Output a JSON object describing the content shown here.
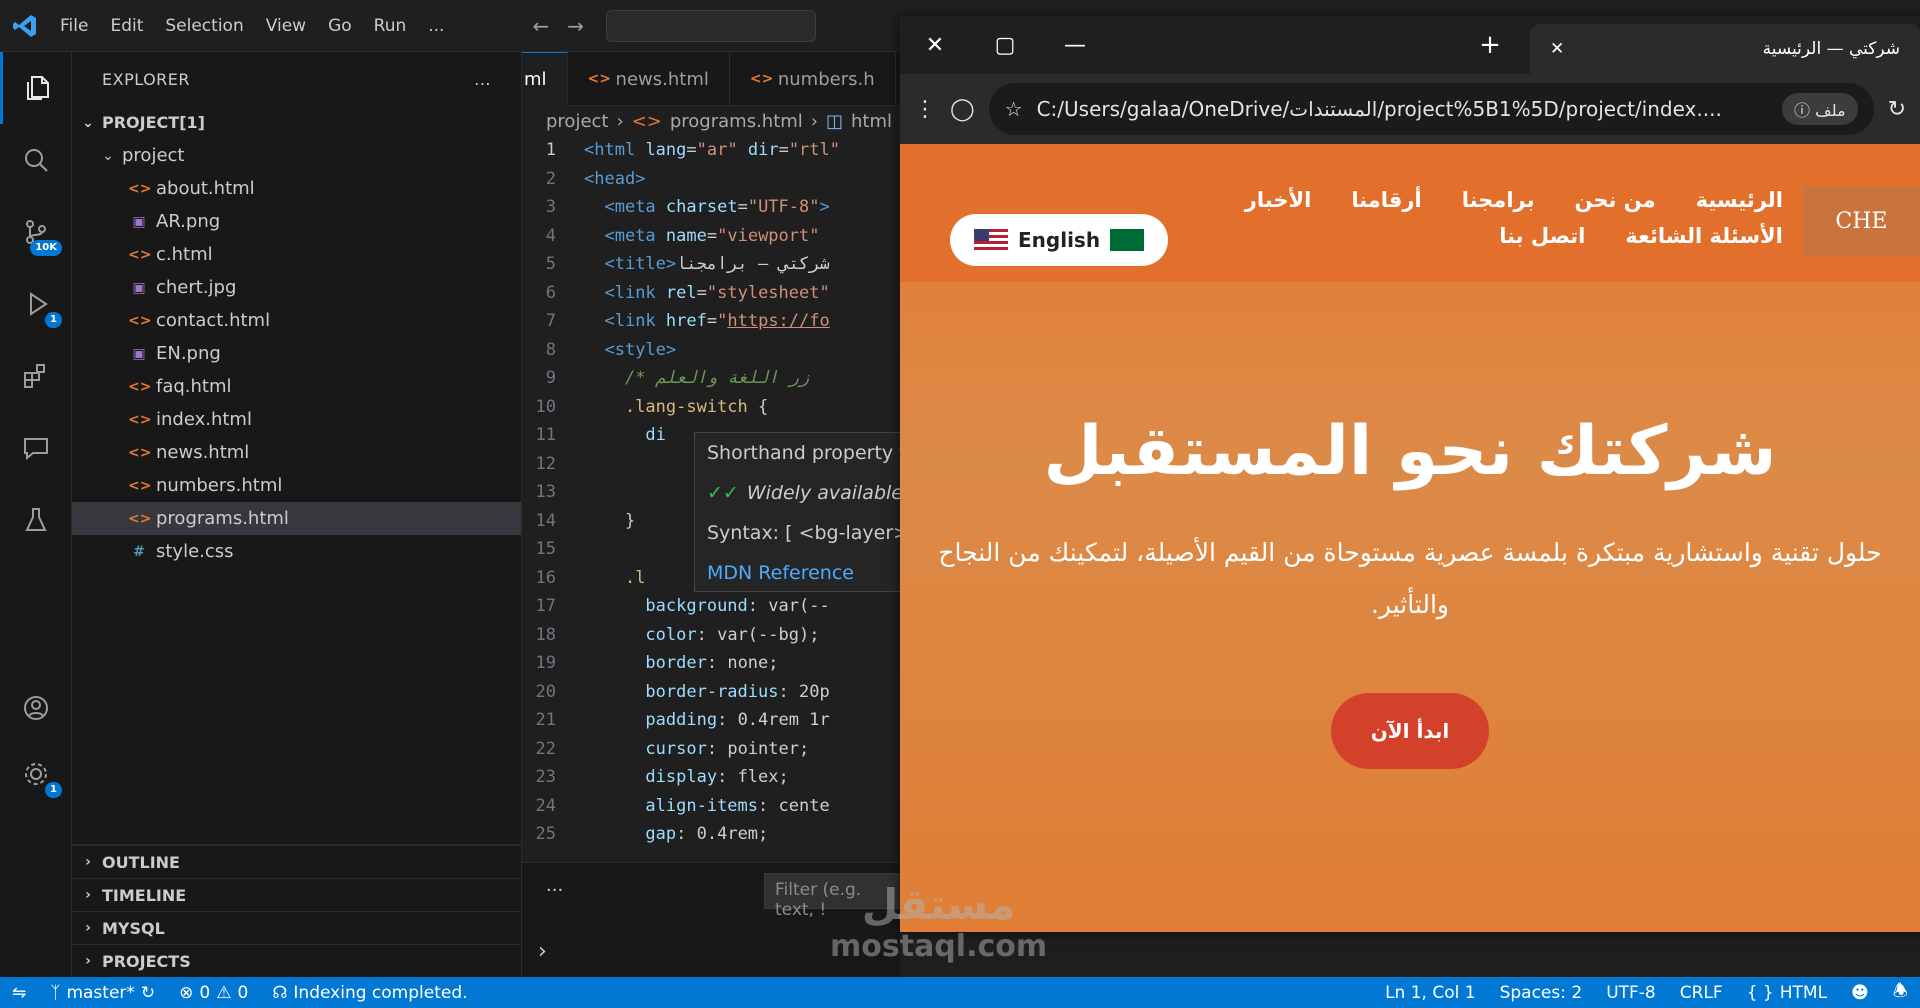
{
  "titlebar": {
    "menu": [
      "File",
      "Edit",
      "Selection",
      "View",
      "Go",
      "Run",
      "..."
    ]
  },
  "activity": {
    "badges": {
      "source_control": "10K",
      "run_debug": "1",
      "accounts_manage": "1"
    }
  },
  "explorer": {
    "title": "EXPLORER",
    "more": "...",
    "root": "PROJECT[1]",
    "folder": "project",
    "files": [
      {
        "name": "about.html",
        "kind": "html"
      },
      {
        "name": "AR.png",
        "kind": "png"
      },
      {
        "name": "c.html",
        "kind": "html"
      },
      {
        "name": "chert.jpg",
        "kind": "png"
      },
      {
        "name": "contact.html",
        "kind": "html"
      },
      {
        "name": "EN.png",
        "kind": "png"
      },
      {
        "name": "faq.html",
        "kind": "html"
      },
      {
        "name": "index.html",
        "kind": "html"
      },
      {
        "name": "news.html",
        "kind": "html"
      },
      {
        "name": "numbers.html",
        "kind": "html"
      },
      {
        "name": "programs.html",
        "kind": "html",
        "selected": true
      },
      {
        "name": "style.css",
        "kind": "css"
      }
    ],
    "sections": [
      "OUTLINE",
      "TIMELINE",
      "MYSQL",
      "PROJECTS"
    ]
  },
  "editor": {
    "tabs": [
      "ml",
      "news.html",
      "numbers.h"
    ],
    "breadcrumb": [
      "project",
      "programs.html",
      "html"
    ],
    "lines": [
      {
        "n": "1",
        "html": "<span class='tk-tag'>&lt;html</span> <span class='tk-attr'>lang</span>=<span class='tk-str'>\"ar\"</span> <span class='tk-attr'>dir</span>=<span class='tk-str'>\"rtl\"</span>"
      },
      {
        "n": "2",
        "html": "<span class='tk-tag'>&lt;head&gt;</span>"
      },
      {
        "n": "3",
        "html": "&nbsp;&nbsp;<span class='tk-tag'>&lt;meta</span> <span class='tk-attr'>charset</span>=<span class='tk-str'>\"UTF-8\"</span><span class='tk-tag'>&gt;</span>"
      },
      {
        "n": "4",
        "html": "&nbsp;&nbsp;<span class='tk-tag'>&lt;meta</span> <span class='tk-attr'>name</span>=<span class='tk-str'>\"viewport\"</span>"
      },
      {
        "n": "5",
        "html": "&nbsp;&nbsp;<span class='tk-tag'>&lt;title&gt;</span><span class='tk-val'>شركتي — برامجنا</span>"
      },
      {
        "n": "6",
        "html": "&nbsp;&nbsp;<span class='tk-tag'>&lt;link</span> <span class='tk-attr'>rel</span>=<span class='tk-str'>\"stylesheet\"</span>"
      },
      {
        "n": "7",
        "html": "&nbsp;&nbsp;<span class='tk-tag'>&lt;link</span> <span class='tk-attr'>href</span>=<span class='tk-str'>\"<u>https://fo</u></span>"
      },
      {
        "n": "8",
        "html": "&nbsp;&nbsp;<span class='tk-tag'>&lt;style&gt;</span>"
      },
      {
        "n": "9",
        "html": "&nbsp;&nbsp;&nbsp;&nbsp;<span class='tk-com'>/* زر اللغة والعلم</span>"
      },
      {
        "n": "10",
        "html": "&nbsp;&nbsp;&nbsp;&nbsp;<span class='tk-sel'>.lang-switch</span> {"
      },
      {
        "n": "11",
        "html": "&nbsp;&nbsp;&nbsp;&nbsp;&nbsp;&nbsp;<span class='tk-attr'>di</span>"
      },
      {
        "n": "12",
        "html": ""
      },
      {
        "n": "13",
        "html": ""
      },
      {
        "n": "14",
        "html": "&nbsp;&nbsp;&nbsp;&nbsp;}"
      },
      {
        "n": "15",
        "html": ""
      },
      {
        "n": "16",
        "html": "&nbsp;&nbsp;&nbsp;&nbsp;<span class='tk-sel'>.l</span>"
      },
      {
        "n": "17",
        "html": "&nbsp;&nbsp;&nbsp;&nbsp;&nbsp;&nbsp;<span class='tk-attr'>background</span>: <span class='tk-val'>var(--</span>"
      },
      {
        "n": "18",
        "html": "&nbsp;&nbsp;&nbsp;&nbsp;&nbsp;&nbsp;<span class='tk-attr'>color</span>: <span class='tk-val'>var(--bg);</span>"
      },
      {
        "n": "19",
        "html": "&nbsp;&nbsp;&nbsp;&nbsp;&nbsp;&nbsp;<span class='tk-attr'>border</span>: <span class='tk-val'>none;</span>"
      },
      {
        "n": "20",
        "html": "&nbsp;&nbsp;&nbsp;&nbsp;&nbsp;&nbsp;<span class='tk-attr'>border-radius</span>: <span class='tk-val'>20p</span>"
      },
      {
        "n": "21",
        "html": "&nbsp;&nbsp;&nbsp;&nbsp;&nbsp;&nbsp;<span class='tk-attr'>padding</span>: <span class='tk-val'>0.4rem 1r</span>"
      },
      {
        "n": "22",
        "html": "&nbsp;&nbsp;&nbsp;&nbsp;&nbsp;&nbsp;<span class='tk-attr'>cursor</span>: <span class='tk-val'>pointer;</span>"
      },
      {
        "n": "23",
        "html": "&nbsp;&nbsp;&nbsp;&nbsp;&nbsp;&nbsp;<span class='tk-attr'>display</span>: <span class='tk-val'>flex;</span>"
      },
      {
        "n": "24",
        "html": "&nbsp;&nbsp;&nbsp;&nbsp;&nbsp;&nbsp;<span class='tk-attr'>align-items</span>: <span class='tk-val'>cente</span>"
      },
      {
        "n": "25",
        "html": "&nbsp;&nbsp;&nbsp;&nbsp;&nbsp;&nbsp;<span class='tk-attr'>gap</span>: <span class='tk-val'>0.4rem;</span>"
      }
    ],
    "hover": {
      "line1": "Shorthand property f",
      "line2": "Widely available a",
      "line3": "Syntax: [ <bg-layer>",
      "link": "MDN Reference"
    },
    "terminal_more": "...",
    "filter_placeholder": "Filter (e.g. text, !"
  },
  "browser": {
    "tab_title": "شركتي — الرئيسية",
    "new_tab": "+",
    "url": "C:/Users/galaa/OneDrive/المستندات/project%5B1%5D/project/index....",
    "file_chip": "ملف",
    "site": {
      "logo": "CHE",
      "nav": [
        "الرئيسية",
        "من نحن",
        "برامجنا",
        "أرقامنا",
        "الأخبار",
        "الأسئلة الشائعة",
        "اتصل بنا"
      ],
      "lang_button": "English",
      "hero_title": "شركتك نحو المستقبل",
      "hero_text": "حلول تقنية واستشارية مبتكرة بلمسة عصرية مستوحاة من القيم الأصيلة، لتمكينك من النجاح والتأثير.",
      "cta": "ابدأ الآن"
    }
  },
  "statusbar": {
    "branch": "master*",
    "errors": "0",
    "warnings": "0",
    "message": "Indexing completed.",
    "position": "Ln 1, Col 1",
    "spaces": "Spaces: 2",
    "encoding": "UTF-8",
    "eol": "CRLF",
    "language": "HTML"
  },
  "watermark": {
    "arabic": "مستقل",
    "latin": "mostaql.com"
  },
  "colors": {
    "accent": "#0078d4",
    "site_orange": "#e2702c",
    "cta_red": "#d4412b"
  }
}
